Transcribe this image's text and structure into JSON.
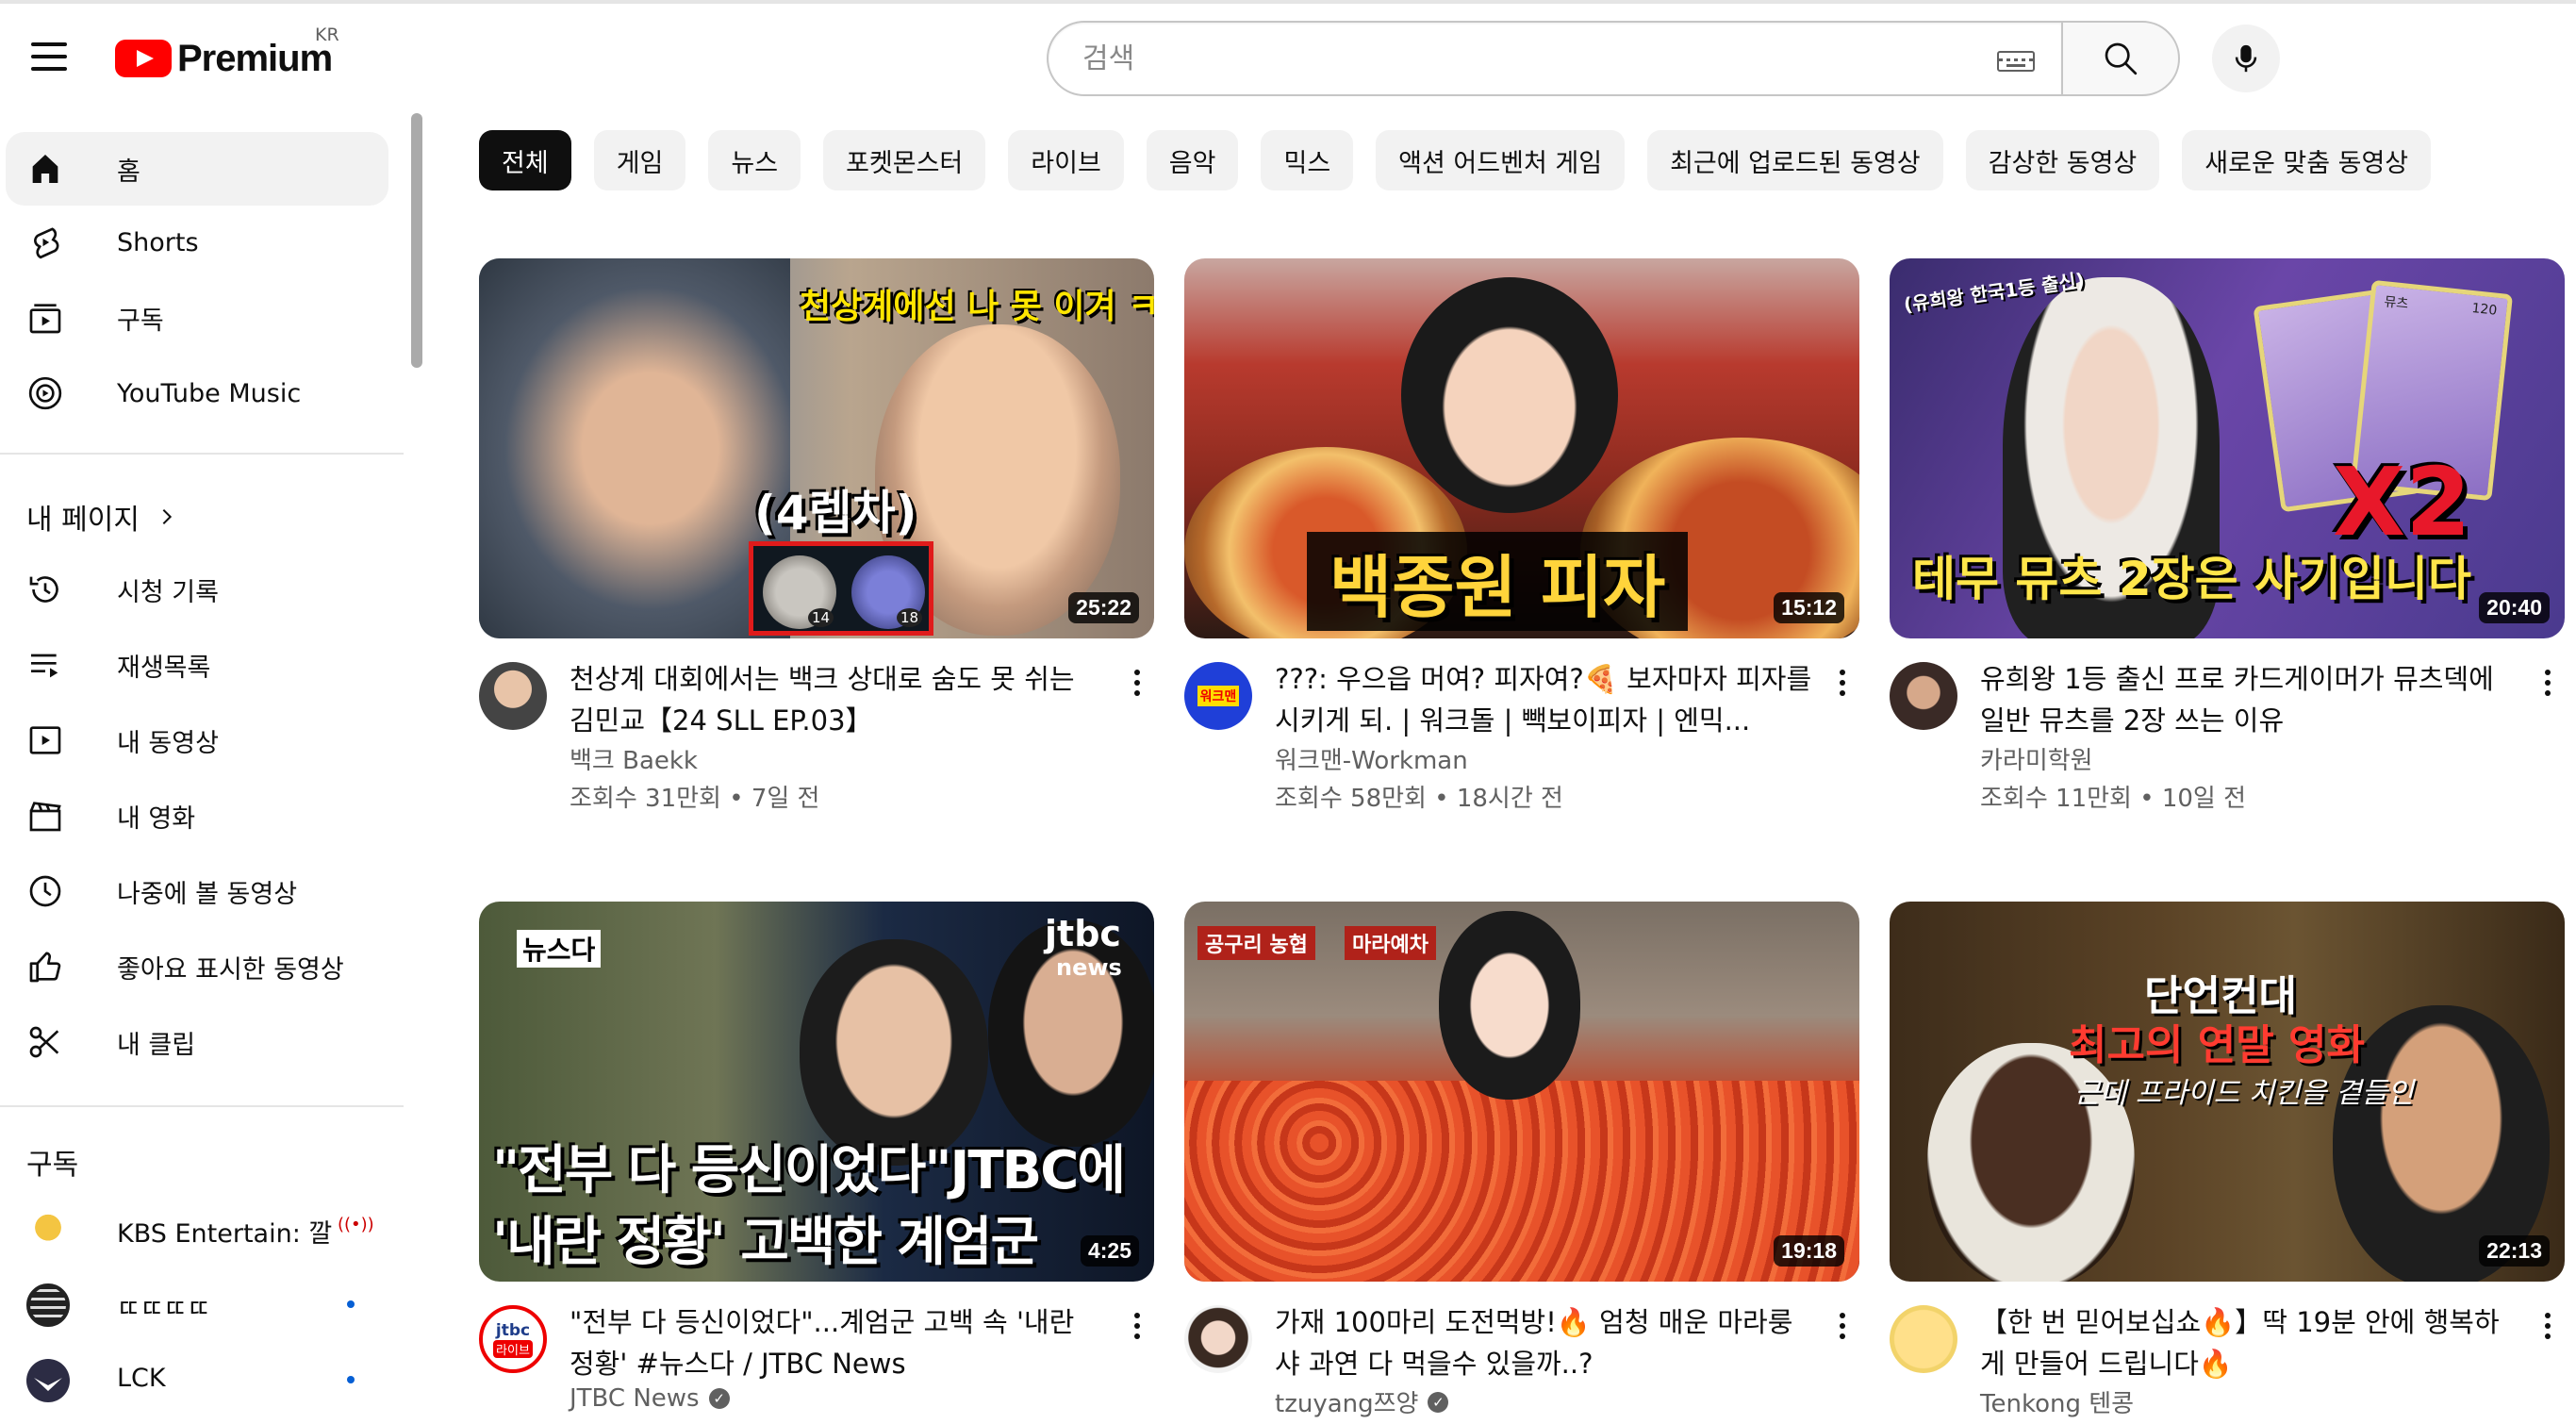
{
  "header": {
    "logo_text": "Premium",
    "region": "KR",
    "search_placeholder": "검색"
  },
  "sidebar": {
    "main": [
      {
        "label": "홈",
        "icon": "home-icon",
        "active": true
      },
      {
        "label": "Shorts",
        "icon": "shorts-icon"
      },
      {
        "label": "구독",
        "icon": "subscriptions-icon"
      },
      {
        "label": "YouTube Music",
        "icon": "youtube-music-icon"
      }
    ],
    "you_title": "내 페이지",
    "you": [
      {
        "label": "시청 기록",
        "icon": "history-icon"
      },
      {
        "label": "재생목록",
        "icon": "playlists-icon"
      },
      {
        "label": "내 동영상",
        "icon": "your-videos-icon"
      },
      {
        "label": "내 영화",
        "icon": "your-movies-icon"
      },
      {
        "label": "나중에 볼 동영상",
        "icon": "watch-later-icon"
      },
      {
        "label": "좋아요 표시한 동영상",
        "icon": "liked-videos-icon"
      },
      {
        "label": "내 클립",
        "icon": "clips-icon"
      }
    ],
    "subs_title": "구독",
    "subs": [
      {
        "label": "KBS Entertain: 깔...",
        "live": "((•))"
      },
      {
        "label": "ㄸㄸㄸㄸ",
        "dot": true
      },
      {
        "label": "LCK",
        "dot": true
      }
    ]
  },
  "chips": [
    "전체",
    "게임",
    "뉴스",
    "포켓몬스터",
    "라이브",
    "음악",
    "믹스",
    "액션 어드벤처 게임",
    "최근에 업로드된 동영상",
    "감상한 동영상",
    "새로운 맞춤 동영상"
  ],
  "videos": [
    {
      "title": "천상계 대회에서는 백크 상대로 숨도 못 쉬는 김민교【24 SLL EP.03】",
      "channel": "백크 Baekk",
      "meta": "조회수 31만회 • 7일 전",
      "duration": "25:22",
      "overlay": [
        "천상계에선 나 못 이겨 ㅋㅋ",
        "(4렙차)",
        "14",
        "18"
      ]
    },
    {
      "title": "???: 우으읍 머여? 피자여?🍕 보자마자 피자를 시키게 되. | 워크돌 | 빽보이피자 | 엔믹...",
      "channel": "워크맨-Workman",
      "meta": "조회수 58만회 • 18시간 전",
      "duration": "15:12",
      "overlay": [
        "백종원 피자"
      ],
      "avatar_text": "워크맨"
    },
    {
      "title": "유희왕 1등 출신 프로 카드게이머가 뮤츠덱에 일반 뮤츠를 2장 쓰는 이유",
      "channel": "카라미학원",
      "meta": "조회수 11만회 • 10일 전",
      "duration": "20:40",
      "overlay": [
        "(유희왕 한국1등 출신)",
        "테무 뮤츠 2장은 사기입니다",
        "X2",
        "뮤츠",
        "120"
      ]
    },
    {
      "title": "\"전부 다 등신이었다\"...계엄군 고백 속 '내란 정황' #뉴스다 / JTBC News",
      "channel": "JTBC News",
      "meta": "",
      "duration": "4:25",
      "verified": true,
      "overlay": [
        "뉴스다",
        "\"전부 다 등신이었다\"JTBC에",
        "'내란 정황' 고백한 계엄군",
        "jtbc",
        "news"
      ],
      "avatar_text": "jtbc",
      "avatar_badge": "라이브"
    },
    {
      "title": "가재 100마리 도전먹방!🔥 엄청 매운 마라룽샤 과연 다 먹을수 있을까..?",
      "channel": "tzuyang쯔양",
      "meta": "",
      "duration": "19:18",
      "verified": true,
      "overlay": [
        "공구리 농협",
        "마라예차"
      ]
    },
    {
      "title": "【한 번 믿어보십쇼🔥】딱 19분 안에 행복하게 만들어 드립니다🔥",
      "channel": "Tenkong 텐콩",
      "meta": "",
      "duration": "22:13",
      "overlay": [
        "단언컨대",
        "최고의 연말 영화",
        "근데 프라이드 치킨을 곁들인"
      ]
    }
  ],
  "colors": {
    "brand": "#ff0000",
    "chip_active": "#0f0f0f",
    "chip_bg": "#f2f2f2",
    "secondary_text": "#606060",
    "live_dot": "#065fd4"
  }
}
